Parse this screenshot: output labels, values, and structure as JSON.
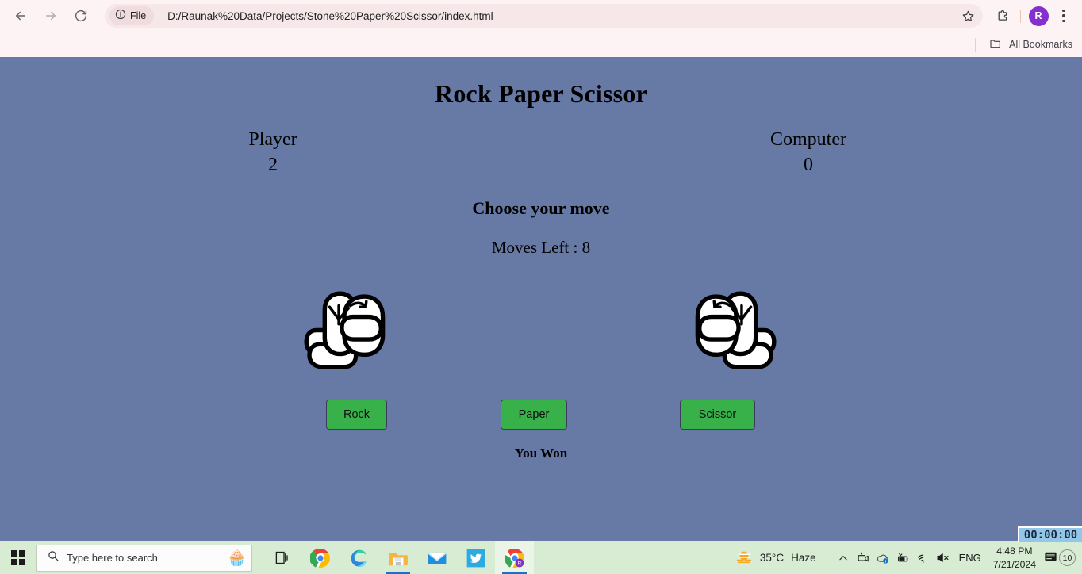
{
  "browser": {
    "back_icon": "arrow-left-icon",
    "forward_icon": "arrow-right-icon",
    "reload_icon": "reload-icon",
    "file_chip_label": "File",
    "file_chip_icon": "info-circle-icon",
    "url": "D:/Raunak%20Data/Projects/Stone%20Paper%20Scissor/index.html",
    "star_icon": "star-outline-icon",
    "extensions_icon": "puzzle-piece-icon",
    "profile_initial": "R",
    "menu_icon": "kebab-menu-icon",
    "bookmarks": {
      "folder_icon": "folder-icon",
      "all_bookmarks_label": "All Bookmarks"
    }
  },
  "page": {
    "background_color": "#6779a5",
    "title": "Rock Paper Scissor",
    "scoreboard": [
      {
        "name": "Player",
        "score": "2"
      },
      {
        "name": "Computer",
        "score": "0"
      }
    ],
    "choose_move_heading": "Choose your move",
    "moves_left_text": "Moves Left : 8",
    "hands": [
      {
        "name": "rock-hand-left",
        "side": "left"
      },
      {
        "name": "rock-hand-right",
        "side": "right"
      }
    ],
    "buttons": [
      {
        "key": "rock",
        "label": "Rock",
        "color": "#38b14a"
      },
      {
        "key": "paper",
        "label": "Paper",
        "color": "#38b14a"
      },
      {
        "key": "scissor",
        "label": "Scissor",
        "color": "#38b14a"
      }
    ],
    "result_text": "You Won"
  },
  "timer_overlay": {
    "value": "00:00:00"
  },
  "taskbar": {
    "start_icon": "windows-logo-icon",
    "search_placeholder": "Type here to search",
    "search_icon": "magnifier-icon",
    "search_decoration_icon": "cupcake-icon",
    "icons": [
      {
        "name": "task-view-icon",
        "running": false
      },
      {
        "name": "google-chrome-icon",
        "running": false
      },
      {
        "name": "microsoft-edge-icon",
        "running": false
      },
      {
        "name": "file-explorer-icon",
        "running": true
      },
      {
        "name": "mail-icon",
        "running": false
      },
      {
        "name": "twitter-icon",
        "running": false
      },
      {
        "name": "chrome-profile-icon",
        "running": true
      }
    ],
    "tray": {
      "weather_icon": "sun-haze-icon",
      "temperature": "35°C",
      "condition": "Haze",
      "chevron_icon": "chevron-up-icon",
      "camera_icon": "camera-icon",
      "onedrive_icon": "onedrive-icon",
      "battery_icon": "battery-icon",
      "wifi_icon": "wifi-icon",
      "volume_icon": "volume-muted-icon",
      "language": "ENG",
      "time": "4:48 PM",
      "date": "7/21/2024",
      "notification_icon": "notification-icon",
      "notification_count": "10"
    }
  }
}
